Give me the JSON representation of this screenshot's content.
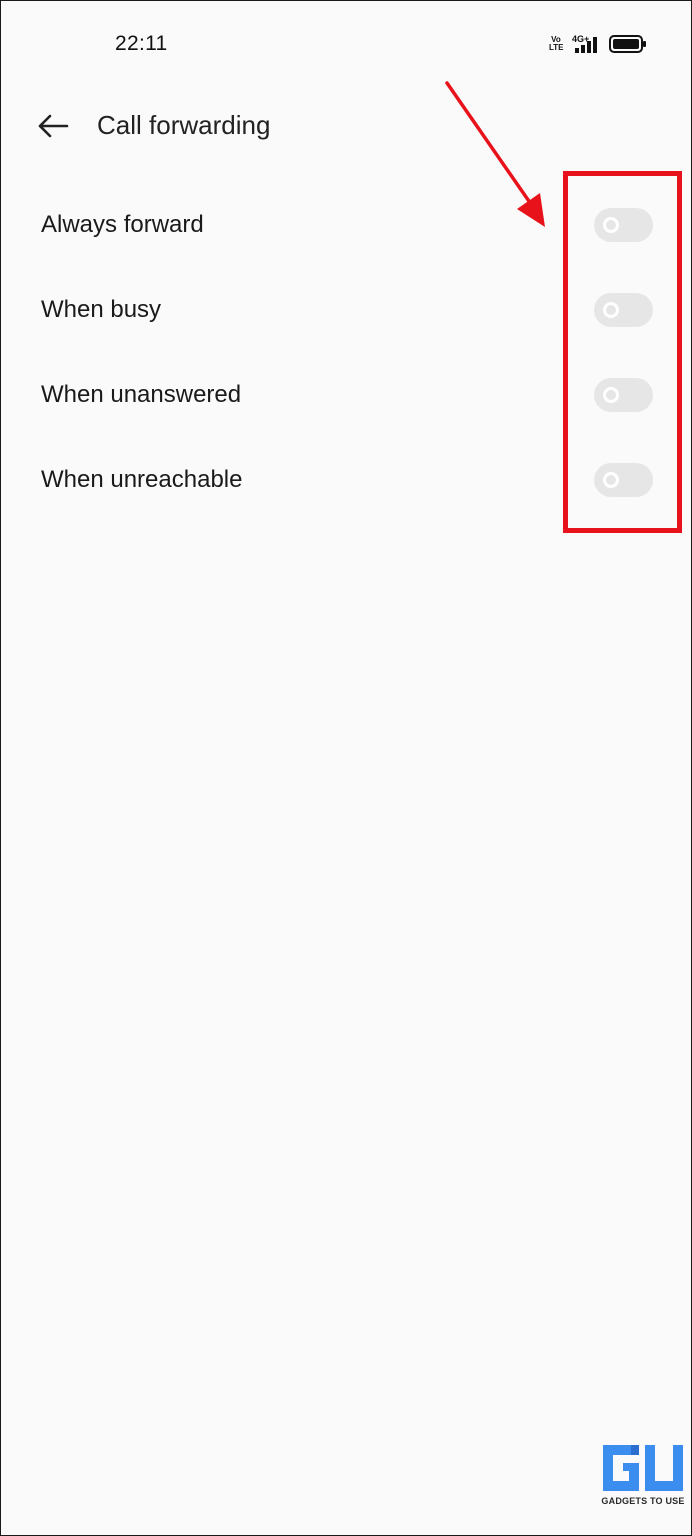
{
  "status_bar": {
    "time": "22:11",
    "volte_top": "Vo",
    "volte_bottom": "LTE",
    "network": "4G+",
    "icons": [
      "volte-icon",
      "signal-icon",
      "battery-icon"
    ]
  },
  "header": {
    "back_icon": "arrow-left-icon",
    "title": "Call forwarding"
  },
  "settings": [
    {
      "label": "Always forward",
      "enabled": false
    },
    {
      "label": "When busy",
      "enabled": false
    },
    {
      "label": "When unanswered",
      "enabled": false
    },
    {
      "label": "When unreachable",
      "enabled": false
    }
  ],
  "annotation": {
    "color": "#e8121b"
  },
  "watermark": {
    "logo": "gadgets-to-use-logo",
    "text": "GADGETS TO USE",
    "logo_color": "#3b8ef0"
  },
  "colors": {
    "background": "#fafafa",
    "toggle_off": "#e6e6e6",
    "text": "#1a1a1a"
  }
}
